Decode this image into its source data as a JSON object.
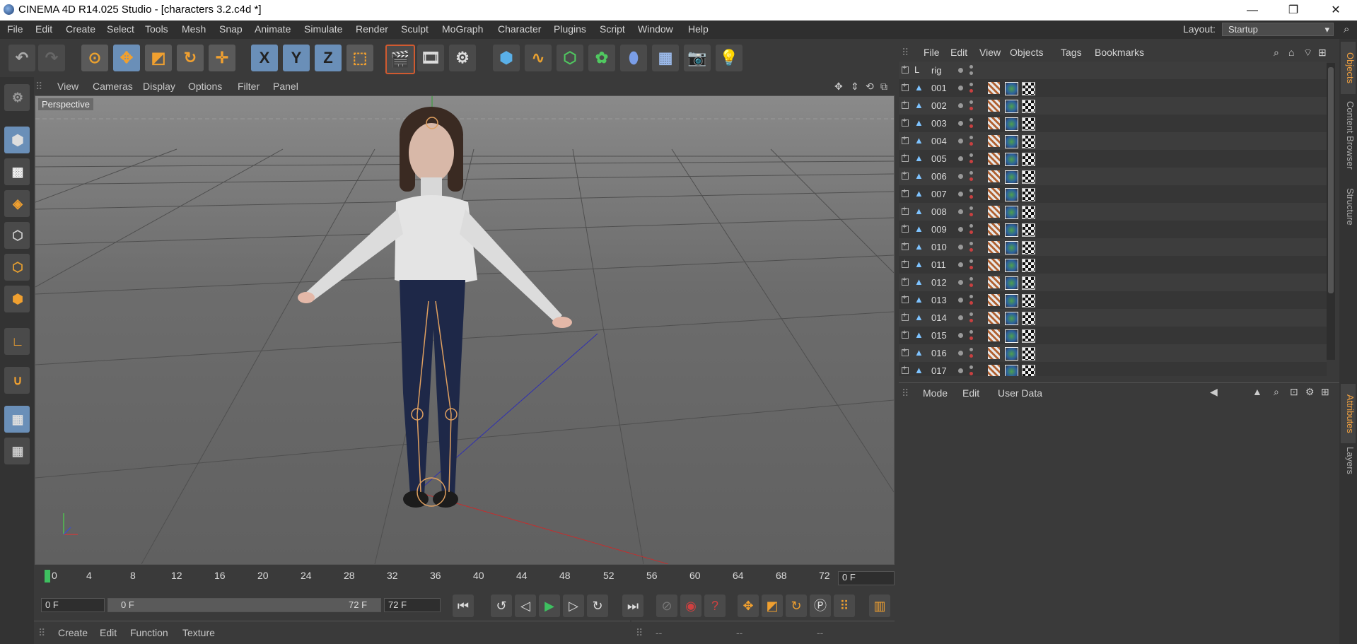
{
  "window": {
    "title": "CINEMA 4D R14.025 Studio - [characters 3.2.c4d *]",
    "minimize": "—",
    "restore": "❐",
    "close": "✕"
  },
  "menubar": {
    "items": [
      "File",
      "Edit",
      "Create",
      "Select",
      "Tools",
      "Mesh",
      "Snap",
      "Animate",
      "Simulate",
      "Render",
      "Sculpt",
      "MoGraph",
      "Character",
      "Plugins",
      "Script",
      "Window",
      "Help"
    ],
    "layout_label": "Layout:",
    "layout_value": "Startup"
  },
  "toolbar": {
    "icons": [
      "undo-icon",
      "redo-icon",
      "live-selection-icon",
      "move-icon",
      "scale-icon",
      "rotate-icon",
      "recent-tool-icon",
      "x-axis-lock-icon",
      "y-axis-lock-icon",
      "z-axis-lock-icon",
      "coordinate-system-icon",
      "render-view-icon",
      "render-to-picture-viewer-icon",
      "render-settings-icon",
      "cube-primitive-icon",
      "spline-icon",
      "nurbs-icon",
      "array-icon",
      "deformer-icon",
      "floor-icon",
      "camera-icon",
      "light-icon"
    ],
    "axis_x": "X",
    "axis_y": "Y",
    "axis_z": "Z"
  },
  "viewport": {
    "menu": [
      "View",
      "Cameras",
      "Display",
      "Options",
      "Filter",
      "Panel"
    ],
    "label": "Perspective"
  },
  "timeline": {
    "ticks": [
      "0",
      "4",
      "8",
      "12",
      "16",
      "20",
      "24",
      "28",
      "32",
      "36",
      "40",
      "44",
      "48",
      "52",
      "56",
      "60",
      "64",
      "68",
      "72"
    ],
    "current_frame": "0 F"
  },
  "playback": {
    "start_field": "0 F",
    "range_min": "0 F",
    "range_max": "72 F",
    "end_field": "72 F"
  },
  "material_manager": {
    "menu": [
      "Create",
      "Edit",
      "Function",
      "Texture"
    ]
  },
  "coord_bar": {
    "cells": [
      "--",
      "--",
      "--"
    ]
  },
  "object_manager": {
    "menu": [
      "File",
      "Edit",
      "View",
      "Objects",
      "Tags",
      "Bookmarks"
    ],
    "objects": [
      {
        "name": "rig",
        "type": "null"
      },
      {
        "name": "001",
        "type": "mesh"
      },
      {
        "name": "002",
        "type": "mesh"
      },
      {
        "name": "003",
        "type": "mesh"
      },
      {
        "name": "004",
        "type": "mesh"
      },
      {
        "name": "005",
        "type": "mesh"
      },
      {
        "name": "006",
        "type": "mesh"
      },
      {
        "name": "007",
        "type": "mesh"
      },
      {
        "name": "008",
        "type": "mesh"
      },
      {
        "name": "009",
        "type": "mesh"
      },
      {
        "name": "010",
        "type": "mesh"
      },
      {
        "name": "011",
        "type": "mesh"
      },
      {
        "name": "012",
        "type": "mesh"
      },
      {
        "name": "013",
        "type": "mesh"
      },
      {
        "name": "014",
        "type": "mesh"
      },
      {
        "name": "015",
        "type": "mesh"
      },
      {
        "name": "016",
        "type": "mesh"
      },
      {
        "name": "017",
        "type": "mesh"
      }
    ]
  },
  "attribute_manager": {
    "menu": [
      "Mode",
      "Edit",
      "User Data"
    ]
  },
  "side_tabs": [
    "Objects",
    "Content Browser",
    "Structure",
    "Attributes",
    "Layers"
  ]
}
